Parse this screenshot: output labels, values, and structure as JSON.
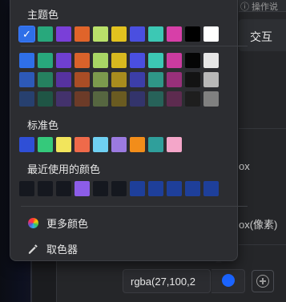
{
  "background": {
    "top_right_text": "操作说",
    "tab_label": "交互",
    "partial_label_1": "ox",
    "partial_label_2": "ox(像素)",
    "color_value": "rgba(27,100,2",
    "current_color": "#1b64ff"
  },
  "popup": {
    "theme_title": "主题色",
    "theme_top_row": [
      "#2f6fe8",
      "#28a87c",
      "#7a3fd8",
      "#e0642a",
      "#b9e06a",
      "#e2c21f",
      "#4a4fe0",
      "#3cc8b4",
      "#d73fa8",
      "#000000",
      "#ffffff"
    ],
    "theme_shades": [
      [
        "#2f6fe8",
        "#28a87c",
        "#6f3fd1",
        "#d9622a",
        "#a8d665",
        "#d8b91f",
        "#4a4fe0",
        "#3cc8b4",
        "#cb3b9f",
        "#050505",
        "#e6e6e6"
      ],
      [
        "#2d59b8",
        "#25815f",
        "#56329f",
        "#a94d25",
        "#7c9a4d",
        "#a88c1e",
        "#3c3ea8",
        "#2f9787",
        "#98307a",
        "#131313",
        "#b8b8b8"
      ],
      [
        "#27406f",
        "#1f5545",
        "#43326c",
        "#6c3b28",
        "#566640",
        "#6a5b21",
        "#33346b",
        "#276259",
        "#5d2b4f",
        "#1e1e1e",
        "#808080"
      ]
    ],
    "standard_title": "标准色",
    "standard_colors": [
      "#2f4fd6",
      "#35c97b",
      "#f2e55c",
      "#ef6a4a",
      "#6fd0f2",
      "#9b7ae0",
      "#f28d1a",
      "#2f9f9b",
      "#f4a6c9"
    ],
    "recent_title": "最近使用的颜色",
    "recent_colors": [
      "#15181f",
      "#15181f",
      "#15181f",
      "#8c5de8",
      "#15181f",
      "#15181f",
      "#1e3f9a",
      "#1e3f9a",
      "#1e3f9a",
      "#1e3f9a",
      "#1e3f9a"
    ],
    "more_colors_label": "更多颜色",
    "more_colors_icon": "color-wheel-icon",
    "picker_label": "取色器",
    "picker_icon": "eyedropper-icon",
    "selected_indicator": "✓"
  }
}
